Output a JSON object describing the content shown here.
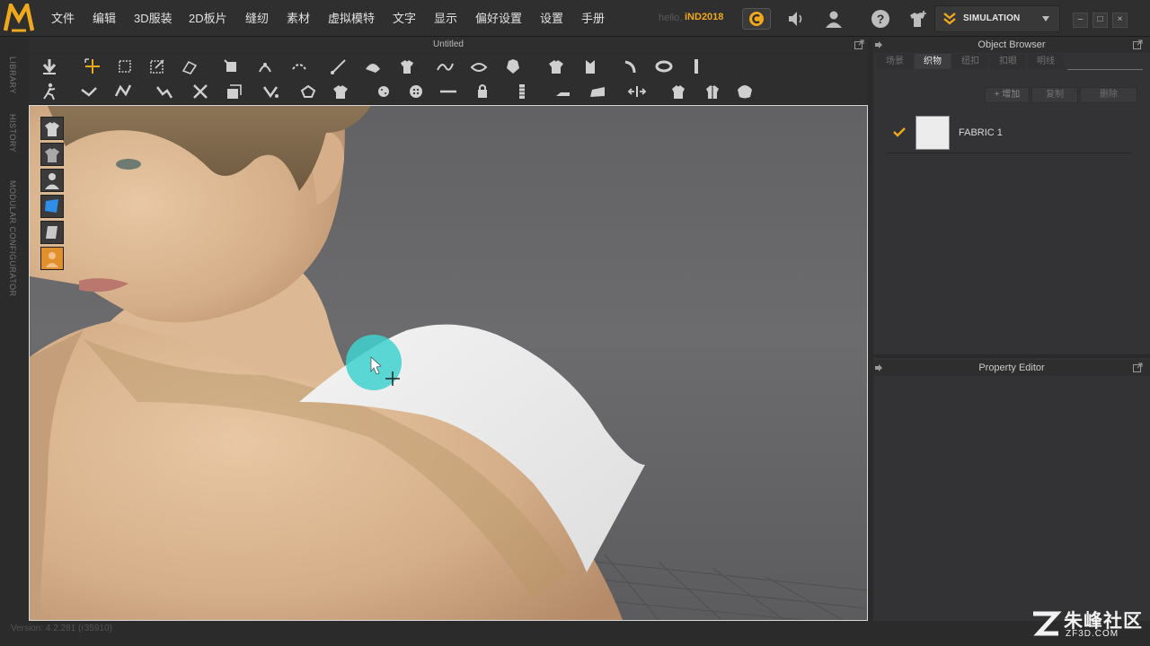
{
  "menubar": {
    "items": [
      "文件",
      "编辑",
      "3D服装",
      "2D板片",
      "缝纫",
      "素材",
      "虚拟模特",
      "文字",
      "显示",
      "偏好设置",
      "设置",
      "手册"
    ],
    "hello_text": "hello,",
    "user_name": "iND2018",
    "simulation_label": "SIMULATION"
  },
  "left_strip": {
    "labels": [
      "LIBRARY",
      "HISTORY",
      "MODULAR CONFIGURATOR"
    ]
  },
  "viewport": {
    "title": "Untitled"
  },
  "object_browser": {
    "title": "Object Browser",
    "tabs": [
      "场景",
      "织物",
      "纽扣",
      "扣眼",
      "明线"
    ],
    "active_tab": "织物",
    "buttons": {
      "add": "+ 增加",
      "copy": "复制",
      "delete": "删除"
    },
    "fabric": {
      "name": "FABRIC 1",
      "checked": true,
      "color": "#ececec"
    }
  },
  "property_editor": {
    "title": "Property Editor"
  },
  "status": {
    "version": "Version: 4.2.281 (r35910)"
  },
  "watermark": {
    "cn": "朱峰社区",
    "en": "ZF3D.COM"
  },
  "colors": {
    "accent": "#f0a81c",
    "brush": "#3fd2d0"
  }
}
